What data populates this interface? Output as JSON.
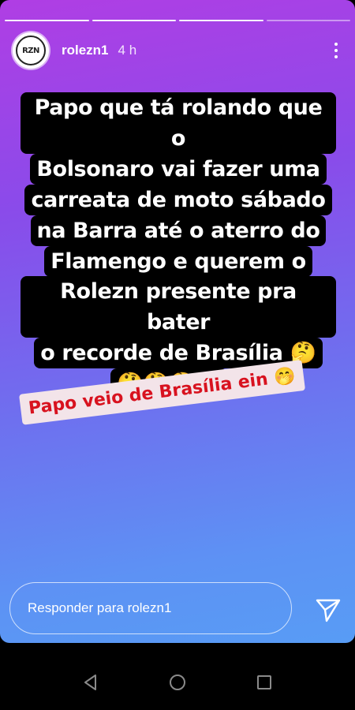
{
  "story": {
    "progress_segments": [
      "done",
      "done",
      "active",
      "pending"
    ],
    "username": "rolezn1",
    "time": "4 h",
    "avatar_text": "RZN",
    "text_lines": [
      "Papo que tá rolando que o",
      "Bolsonaro vai fazer uma",
      "carreata de moto sábado",
      "na Barra até o aterro do",
      "Flamengo e querem o",
      "Rolezn presente pra bater",
      "o recorde de Brasília 🤔",
      "🤔🤔🤔🤔"
    ],
    "tag_text": "Papo veio de Brasília ein 🤭"
  },
  "reply": {
    "placeholder": "Responder para rolezn1"
  },
  "icons": {
    "more": "more-vertical-icon",
    "send": "paper-plane-icon",
    "back": "back-triangle-icon",
    "home": "home-circle-icon",
    "recents": "recents-square-icon"
  },
  "colors": {
    "gradient_top": "#b03ee4",
    "gradient_bottom": "#589cf5",
    "tag_text": "#d8121f",
    "tag_bg": "#f3e4e9"
  }
}
